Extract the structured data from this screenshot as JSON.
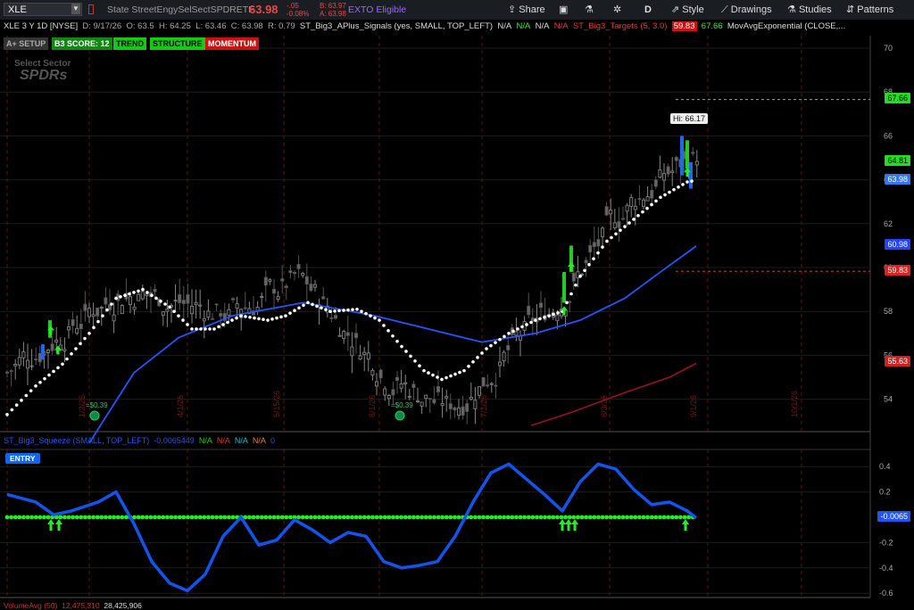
{
  "toolbar": {
    "symbol": "XLE",
    "description": "State StreetEngySelSectSPDRETF",
    "last": "63.98",
    "change": "-.05",
    "change_pct": "-0.08%",
    "bid": "B: 63.97",
    "ask": "A: 63.98",
    "exto": "EXTO Eligible",
    "share": "Share",
    "period": "D",
    "style": "Style",
    "drawings": "Drawings",
    "studies": "Studies",
    "patterns": "Patterns"
  },
  "info": {
    "title": "XLE 3 Y 1D [NYSE]",
    "date": "D: 9/17/26",
    "open": "O: 63.5",
    "high": "H: 64.25",
    "low": "L: 63.46",
    "close": "C: 63.98",
    "range": "R: 0.79",
    "study1": "ST_Big3_APlus_Signals (yes, SMALL, TOP_LEFT)",
    "na1": "N/A",
    "na2": "N/A",
    "na3": "N/A",
    "na4": "N/A",
    "study2": "ST_Big3_Targets (5, 3.0)",
    "t1": "59.83",
    "t2": "67.66",
    "study3": "MovAvgExponential (CLOSE,..."
  },
  "badges": {
    "aplus": "A+ SETUP",
    "score": "B3 SCORE: 12",
    "trend": "TREND",
    "structure": "STRUCTURE",
    "momentum": "MOMENTUM"
  },
  "watermark": {
    "line1": "Select Sector",
    "line2": "SPDRs"
  },
  "price_axis": {
    "ticks": [
      "70",
      "68",
      "66",
      "64",
      "62",
      "60",
      "58",
      "56",
      "54"
    ]
  },
  "price_labels": {
    "target_high": "67.66",
    "green": "64.81",
    "last": "63.98",
    "ema": "60.98",
    "target_low": "59.83",
    "lower": "55.63"
  },
  "hi_tooltip": "Hi: 66.17",
  "dividends": [
    "=$0.39",
    "=$0.39"
  ],
  "date_labels": [
    "1/2/26",
    "4/1/26",
    "5/15/26",
    "6/1/26",
    "7/1/26",
    "8/3/26",
    "9/1/26",
    "10/1/26"
  ],
  "lower_panel": {
    "study": "ST_Big3_Squeeze (SMALL, TOP_LEFT)",
    "value": "-0.0065449",
    "na1": "N/A",
    "na2": "N/A",
    "na3": "N/A",
    "na4": "N/A",
    "zero": "0",
    "entry": "ENTRY",
    "axis": [
      "0.4",
      "0.2",
      "-0.2",
      "-0.4",
      "-0.6"
    ],
    "current": "-0.0065"
  },
  "volume": {
    "label": "VolumeAvg (50)",
    "v1": "12,475,310",
    "v2": "28,425,906"
  },
  "colors": {
    "ema": "#2255ff",
    "target_green": "#22dd22",
    "target_red": "#dd2222",
    "squeeze": "#1155ee",
    "dots": "#ffffff"
  }
}
